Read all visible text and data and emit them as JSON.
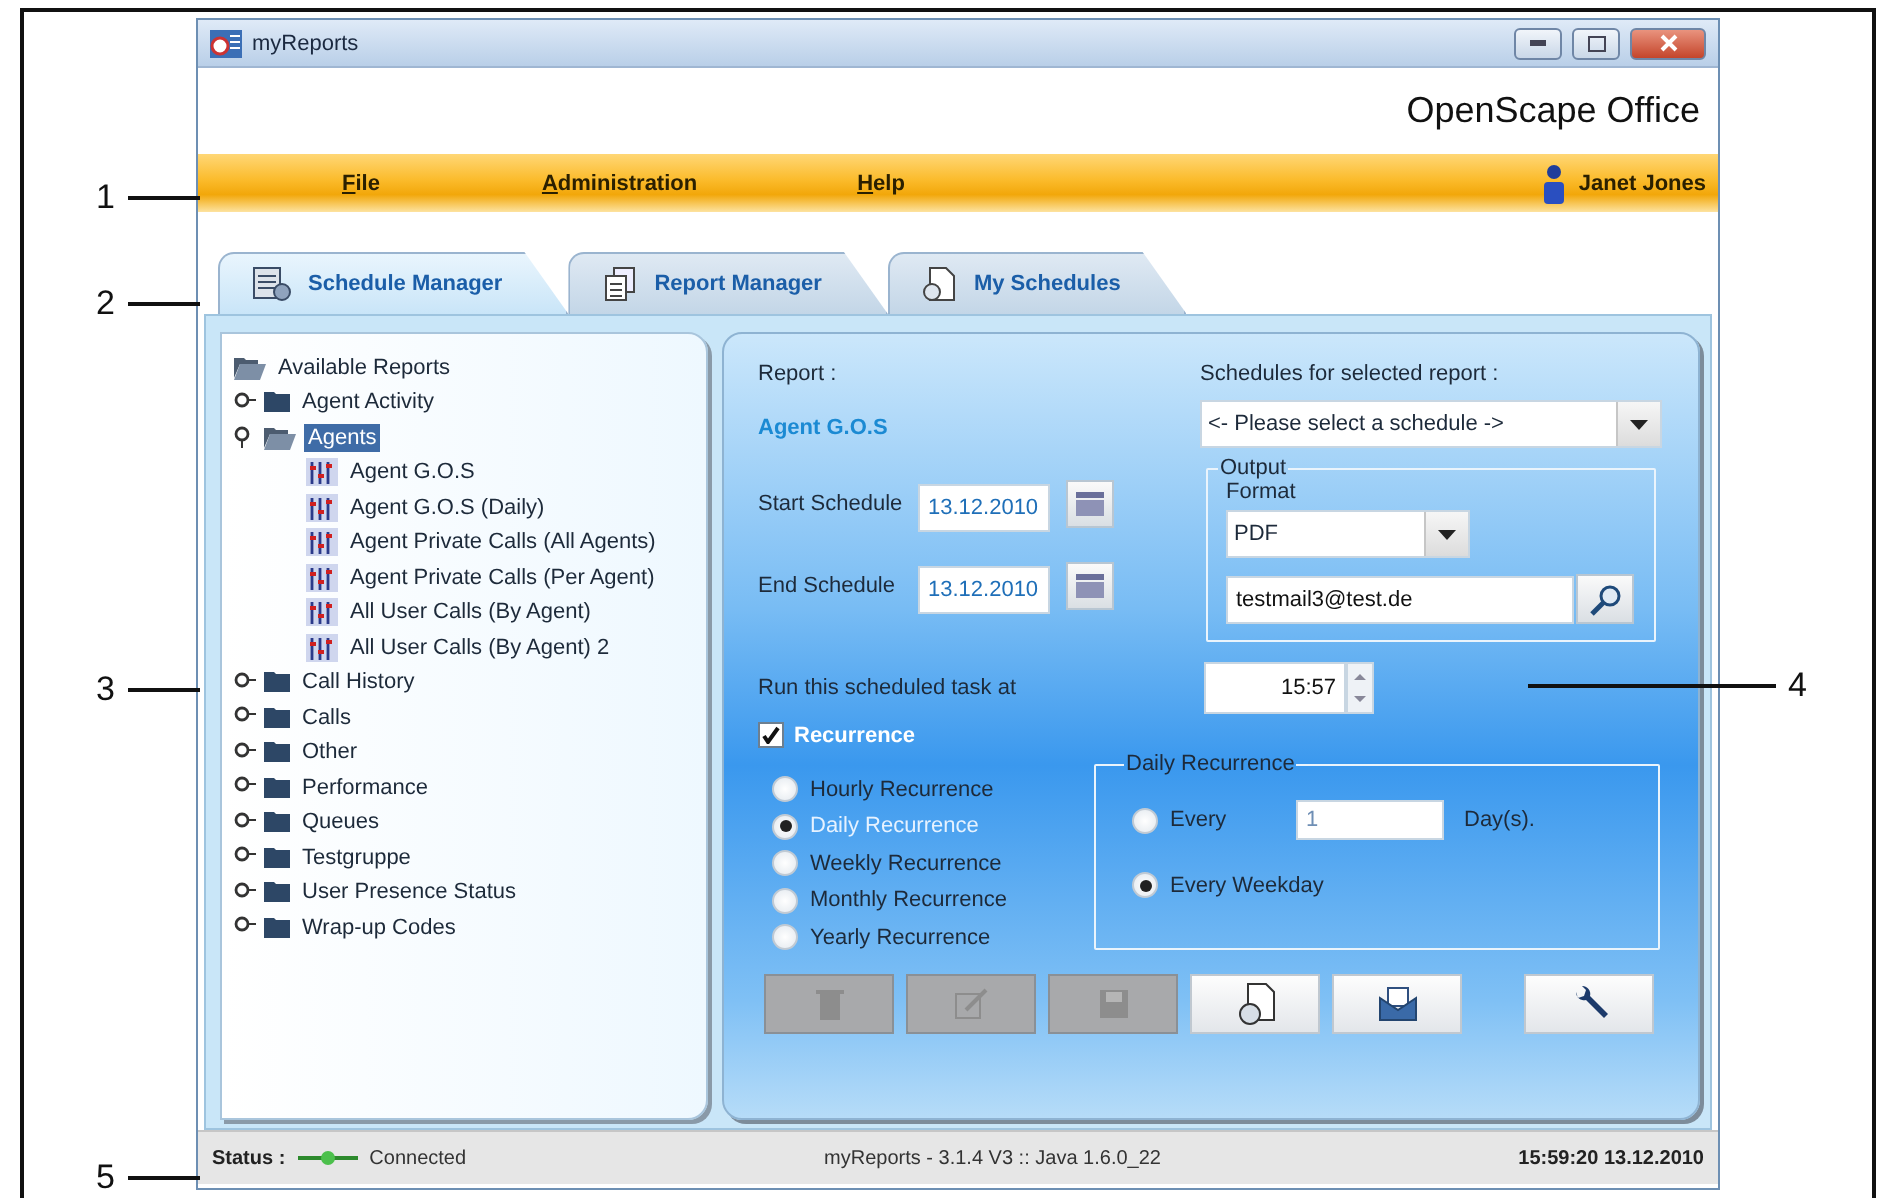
{
  "window": {
    "title": "myReports",
    "brand": "OpenScape Office"
  },
  "menu": [
    {
      "label": "File"
    },
    {
      "label": "Administration"
    },
    {
      "label": "Help"
    }
  ],
  "user": "Janet Jones",
  "tabs": [
    {
      "label": "Schedule Manager",
      "selected": true,
      "kind": "schedule"
    },
    {
      "label": "Report Manager",
      "selected": false,
      "kind": "report"
    },
    {
      "label": "My Schedules",
      "selected": false,
      "kind": "mine"
    }
  ],
  "tree": {
    "label": "Available Reports",
    "children": [
      {
        "label": "Agent Activity",
        "kind": "folder",
        "expanded": false,
        "selected": false
      },
      {
        "label": "Agents",
        "kind": "folder",
        "expanded": true,
        "selected": true,
        "children": [
          {
            "label": "Agent G.O.S",
            "kind": "report",
            "selected": false
          },
          {
            "label": "Agent G.O.S (Daily)",
            "kind": "report",
            "selected": false
          },
          {
            "label": "Agent Private Calls (All Agents)",
            "kind": "report",
            "selected": false
          },
          {
            "label": "Agent Private Calls (Per Agent)",
            "kind": "report",
            "selected": false
          },
          {
            "label": "All User Calls (By Agent)",
            "kind": "report",
            "selected": false
          },
          {
            "label": "All User Calls (By Agent) 2",
            "kind": "report",
            "selected": false
          }
        ]
      },
      {
        "label": "Call History",
        "kind": "folder",
        "expanded": false,
        "selected": false
      },
      {
        "label": "Calls",
        "kind": "folder",
        "expanded": false,
        "selected": false
      },
      {
        "label": "Other",
        "kind": "folder",
        "expanded": false,
        "selected": false
      },
      {
        "label": "Performance",
        "kind": "folder",
        "expanded": false,
        "selected": false
      },
      {
        "label": "Queues",
        "kind": "folder",
        "expanded": false,
        "selected": false
      },
      {
        "label": "Testgruppe",
        "kind": "folder",
        "expanded": false,
        "selected": false
      },
      {
        "label": "User Presence Status",
        "kind": "folder",
        "expanded": false,
        "selected": false
      },
      {
        "label": "Wrap-up Codes",
        "kind": "folder",
        "expanded": false,
        "selected": false
      }
    ]
  },
  "form": {
    "report_label": "Report :",
    "report_name": "Agent G.O.S",
    "start_label": "Start Schedule",
    "start_date": "13.12.2010",
    "end_label": "End Schedule",
    "end_date": "13.12.2010",
    "schedules_label": "Schedules for selected report :",
    "schedule": "<- Please select a schedule ->",
    "output": {
      "legend": "Output",
      "format_label": "Format",
      "format": "PDF",
      "email": "testmail3@test.de"
    },
    "run_label": "Run this scheduled task at",
    "run_time": "15:57",
    "recurrence": {
      "label": "Recurrence",
      "checked": true,
      "options": [
        {
          "label": "Hourly Recurrence",
          "selected": false
        },
        {
          "label": "Daily Recurrence",
          "selected": true
        },
        {
          "label": "Weekly Recurrence",
          "selected": false
        },
        {
          "label": "Monthly Recurrence",
          "selected": false
        },
        {
          "label": "Yearly Recurrence",
          "selected": false
        }
      ],
      "daily": {
        "legend": "Daily Recurrence",
        "options": [
          {
            "label": "Every",
            "kind": "interval",
            "selected": false,
            "value": "1",
            "unit": "Day(s)."
          },
          {
            "label": "Every Weekday",
            "kind": "plain",
            "selected": true
          }
        ]
      }
    }
  },
  "actions": [
    {
      "kind": "delete",
      "disabled": true
    },
    {
      "kind": "edit",
      "disabled": true
    },
    {
      "kind": "save",
      "disabled": true
    },
    {
      "kind": "new",
      "disabled": false
    },
    {
      "kind": "send",
      "disabled": false
    },
    {
      "kind": "settings",
      "disabled": false
    }
  ],
  "status_bar": {
    "label": "Status :",
    "connection": "Connected",
    "version": "myReports - 3.1.4 V3 :: Java 1.6.0_22",
    "datetime": "15:59:20 13.12.2010"
  },
  "callouts": [
    {
      "number": "1"
    },
    {
      "number": "2"
    },
    {
      "number": "3"
    },
    {
      "number": "4"
    },
    {
      "number": "5"
    }
  ]
}
